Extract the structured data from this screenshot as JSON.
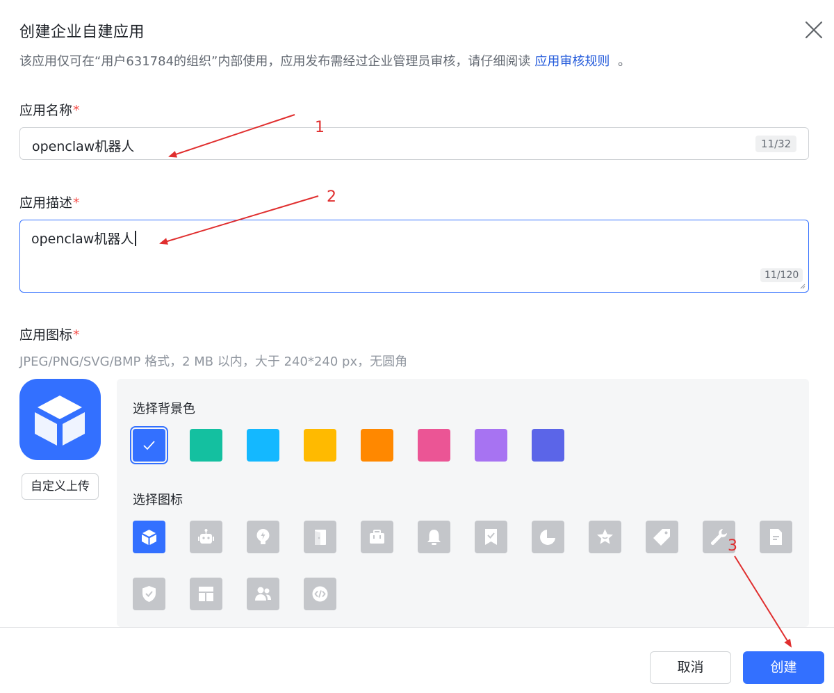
{
  "dialog": {
    "title": "创建企业自建应用",
    "subtitle": "该应用仅可在“用户631784的组织”内部使用，应用发布需经过企业管理员审核，请仔细阅读",
    "review_link": "应用审核规则",
    "subtitle_end": "。"
  },
  "name_field": {
    "label": "应用名称",
    "required_mark": "*",
    "value": "openclaw机器人",
    "counter": "11/32"
  },
  "description_field": {
    "label": "应用描述",
    "required_mark": "*",
    "value": "openclaw机器人",
    "counter": "11/120"
  },
  "icon_field": {
    "label": "应用图标",
    "required_mark": "*",
    "hint": "JPEG/PNG/SVG/BMP 格式，2 MB 以内，大于 240*240 px，无圆角",
    "upload_label": "自定义上传",
    "bg_label": "选择背景色",
    "icon_label": "选择图标",
    "bg_colors": [
      "#3370ff",
      "#14c0a0",
      "#14b8ff",
      "#ffba00",
      "#ff8800",
      "#eb5595",
      "#a773f2",
      "#5b65e8"
    ],
    "selected_bg_index": 0,
    "icons": [
      "cube-icon",
      "robot-icon",
      "lightbulb-icon",
      "door-icon",
      "briefcase-icon",
      "bell-icon",
      "bookmark-check-icon",
      "pie-chart-icon",
      "star-icon",
      "tag-icon",
      "wrench-icon",
      "document-icon",
      "shield-check-icon",
      "layout-icon",
      "users-icon",
      "code-icon"
    ],
    "selected_icon_index": 0
  },
  "footer": {
    "cancel_label": "取消",
    "create_label": "创建"
  },
  "annotations": {
    "n1": "1",
    "n2": "2",
    "n3": "3"
  },
  "colors": {
    "accent": "#3370ff",
    "required": "#f54a45",
    "annotation": "#e02e2e"
  }
}
